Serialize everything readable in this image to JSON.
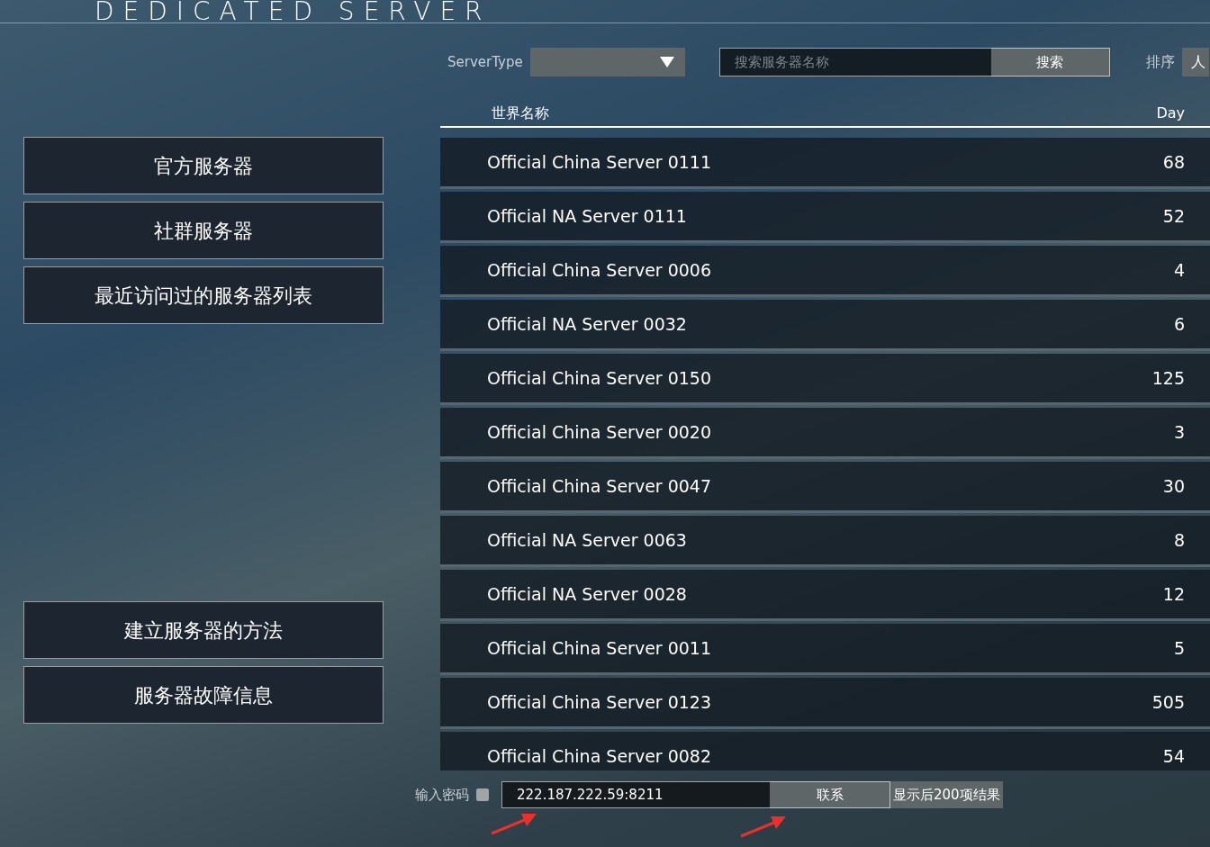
{
  "title": "DEDICATED SERVER",
  "filters": {
    "server_type_label": "ServerType",
    "search_placeholder": "搜索服务器名称",
    "search_button": "搜索",
    "sort_label": "排序",
    "sort_value": "人"
  },
  "sidebar": {
    "top": [
      {
        "label": "官方服务器"
      },
      {
        "label": "社群服务器"
      },
      {
        "label": "最近访问过的服务器列表"
      }
    ],
    "bottom": [
      {
        "label": "建立服务器的方法"
      },
      {
        "label": "服务器故障信息"
      }
    ]
  },
  "table": {
    "columns": [
      "世界名称",
      "Day"
    ],
    "rows": [
      {
        "name": "Official China Server 0111",
        "day": "68"
      },
      {
        "name": "Official NA Server 0111",
        "day": "52"
      },
      {
        "name": "Official China Server 0006",
        "day": "4"
      },
      {
        "name": "Official NA Server 0032",
        "day": "6"
      },
      {
        "name": "Official China Server 0150",
        "day": "125"
      },
      {
        "name": "Official China Server 0020",
        "day": "3"
      },
      {
        "name": "Official China Server 0047",
        "day": "30"
      },
      {
        "name": "Official NA Server 0063",
        "day": "8"
      },
      {
        "name": "Official NA Server 0028",
        "day": "12"
      },
      {
        "name": "Official China Server 0011",
        "day": "5"
      },
      {
        "name": "Official China Server 0123",
        "day": "505"
      },
      {
        "name": "Official China Server 0082",
        "day": "54"
      }
    ]
  },
  "footer": {
    "password_label": "输入密码",
    "password_checked": false,
    "address": "222.187.222.59:8211",
    "connect_button": "联系",
    "next_button": "显示后200项结果"
  },
  "annotations": [
    {
      "kind": "arrow"
    },
    {
      "kind": "arrow"
    }
  ]
}
